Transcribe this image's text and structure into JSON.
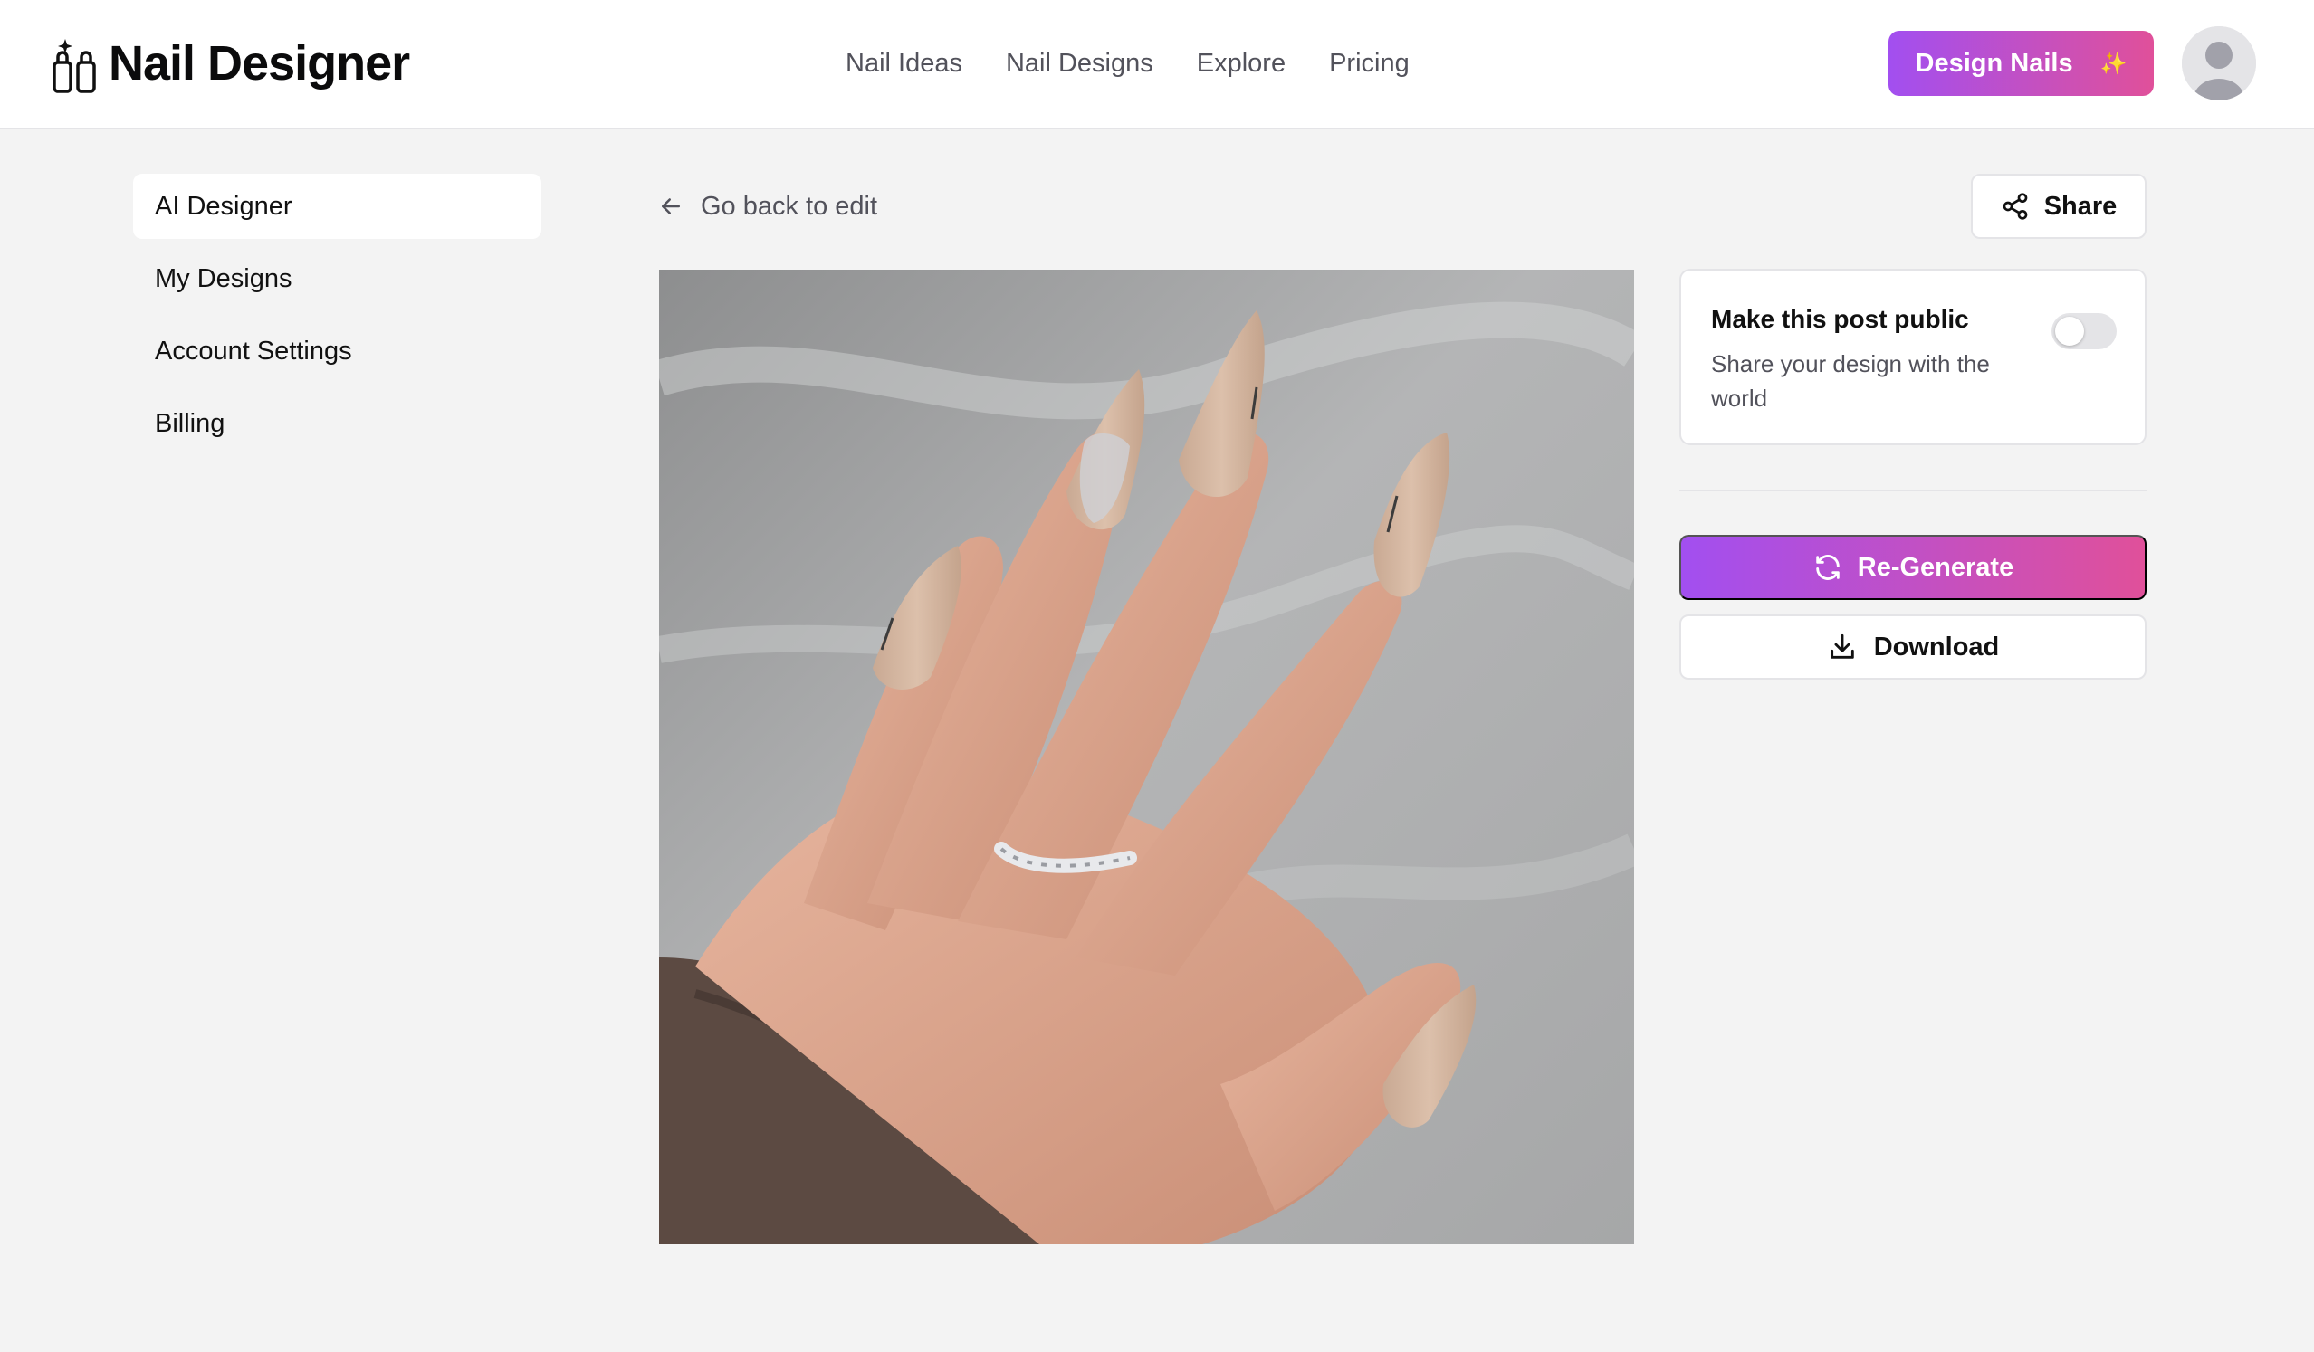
{
  "brand": {
    "name": "Nail Designer",
    "icon": "nail-polish-sparkle-icon"
  },
  "nav": {
    "items": [
      {
        "label": "Nail Ideas"
      },
      {
        "label": "Nail Designs"
      },
      {
        "label": "Explore"
      },
      {
        "label": "Pricing"
      }
    ]
  },
  "header": {
    "cta_label": "Design Nails",
    "cta_icon": "sparkles-icon",
    "avatar_icon": "user-avatar-icon"
  },
  "sidebar": {
    "items": [
      {
        "label": "AI Designer",
        "active": true
      },
      {
        "label": "My Designs",
        "active": false
      },
      {
        "label": "Account Settings",
        "active": false
      },
      {
        "label": "Billing",
        "active": false
      }
    ]
  },
  "editor": {
    "back_label": "Go back to edit",
    "back_icon": "arrow-left-icon",
    "share_label": "Share",
    "share_icon": "share-icon"
  },
  "publish": {
    "title": "Make this post public",
    "subtitle": "Share your design with the world",
    "is_public": false
  },
  "actions": {
    "regenerate_label": "Re-Generate",
    "regenerate_icon": "refresh-icon",
    "download_label": "Download",
    "download_icon": "download-icon"
  },
  "colors": {
    "accent_start": "#a24ff0",
    "accent_end": "#e0509a",
    "page_bg": "#f3f3f3"
  }
}
